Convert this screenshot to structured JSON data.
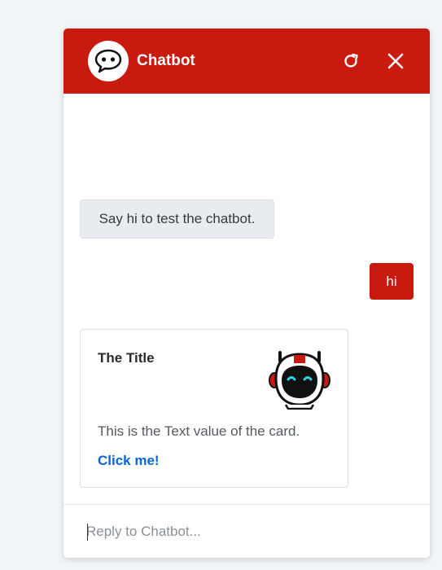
{
  "header": {
    "title": "Chatbot",
    "refresh_icon": "refresh-icon",
    "close_icon": "close-icon",
    "avatar_icon": "chat-bubble-icon",
    "color": "#c81a0f"
  },
  "messages": {
    "bot_greeting": "Say hi to test the chatbot.",
    "user_reply": "hi"
  },
  "card": {
    "title": "The Title",
    "text": "This is the Text value of the card.",
    "link_label": "Click me!",
    "image_icon": "robot-icon"
  },
  "composer": {
    "placeholder": "Reply to Chatbot...",
    "value": ""
  }
}
